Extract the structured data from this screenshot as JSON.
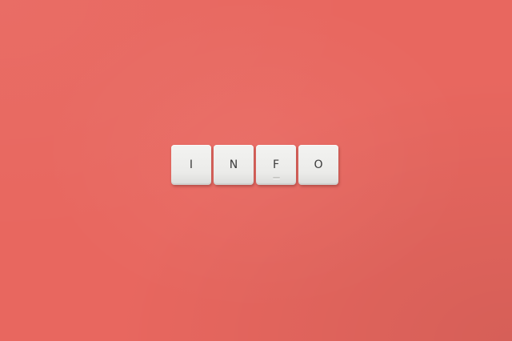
{
  "colors": {
    "background": "#e8675f",
    "key_face": "#efefed",
    "key_letter": "#3a3a3a"
  },
  "keys": [
    {
      "letter": "I"
    },
    {
      "letter": "N"
    },
    {
      "letter": "F"
    },
    {
      "letter": "O"
    }
  ]
}
